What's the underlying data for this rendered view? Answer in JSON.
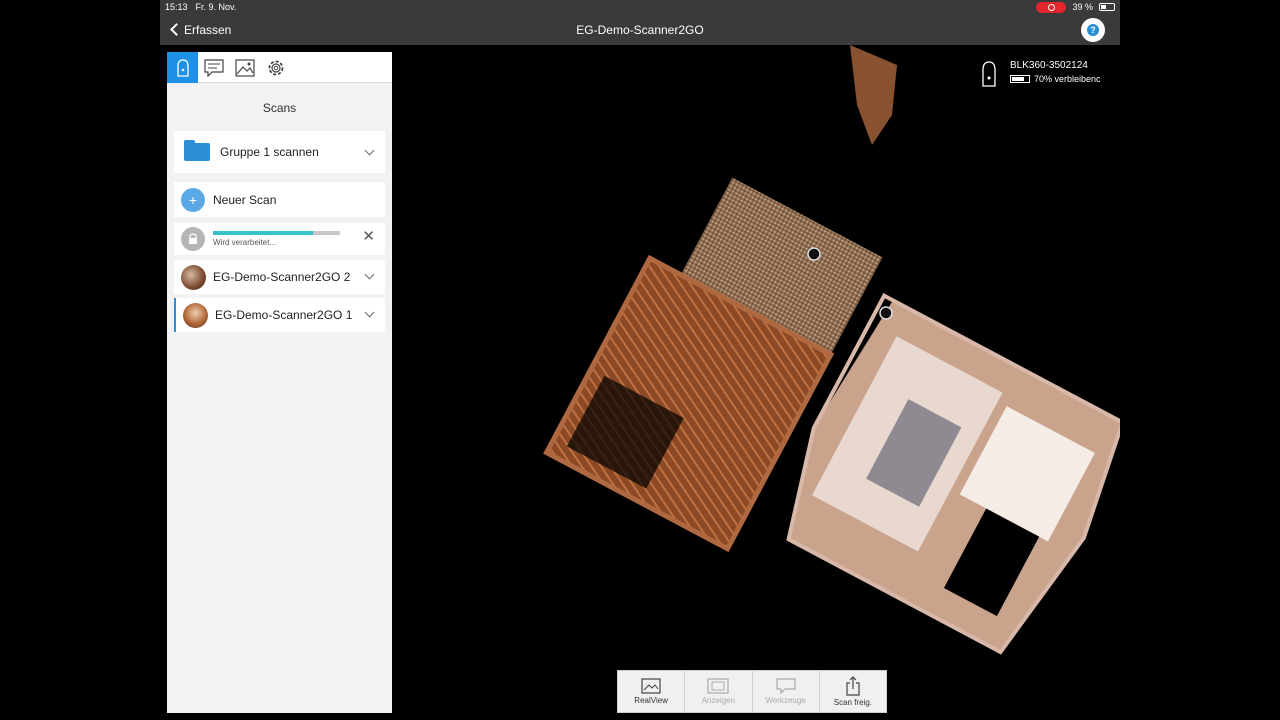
{
  "statusbar": {
    "time": "15:13",
    "date": "Fr. 9. Nov.",
    "battery_text": "39 %"
  },
  "navbar": {
    "back_label": "Erfassen",
    "title": "EG-Demo-Scanner2GO",
    "help_icon": "help-icon"
  },
  "panel": {
    "tabs": [
      {
        "name": "scanner-tab",
        "icon": "scanner-icon",
        "active": true
      },
      {
        "name": "notes-tab",
        "icon": "notes-icon",
        "active": false
      },
      {
        "name": "images-tab",
        "icon": "image-icon",
        "active": false
      },
      {
        "name": "settings-tab",
        "icon": "gear-icon",
        "active": false
      }
    ],
    "title": "Scans",
    "group": {
      "label": "Gruppe 1 scannen"
    },
    "new_scan": {
      "label": "Neuer Scan"
    },
    "processing": {
      "status": "Wird verarbeitet...",
      "progress": 0.79
    },
    "scans": [
      {
        "label": "EG-Demo-Scanner2GO 2",
        "selected": false
      },
      {
        "label": "EG-Demo-Scanner2GO 1",
        "selected": true
      }
    ]
  },
  "scanner": {
    "id": "BLK360-3502124",
    "battery": "70% verbleibenc"
  },
  "toolbar": {
    "items": [
      {
        "label": "RealView",
        "enabled": true
      },
      {
        "label": "Anzeigen",
        "enabled": false
      },
      {
        "label": "Werkzeuge",
        "enabled": false
      },
      {
        "label": "Scan freig.",
        "enabled": true
      }
    ]
  },
  "colors": {
    "accent": "#1e90e6",
    "progress": "#39c1c9",
    "bar": "#3a3a3c"
  }
}
